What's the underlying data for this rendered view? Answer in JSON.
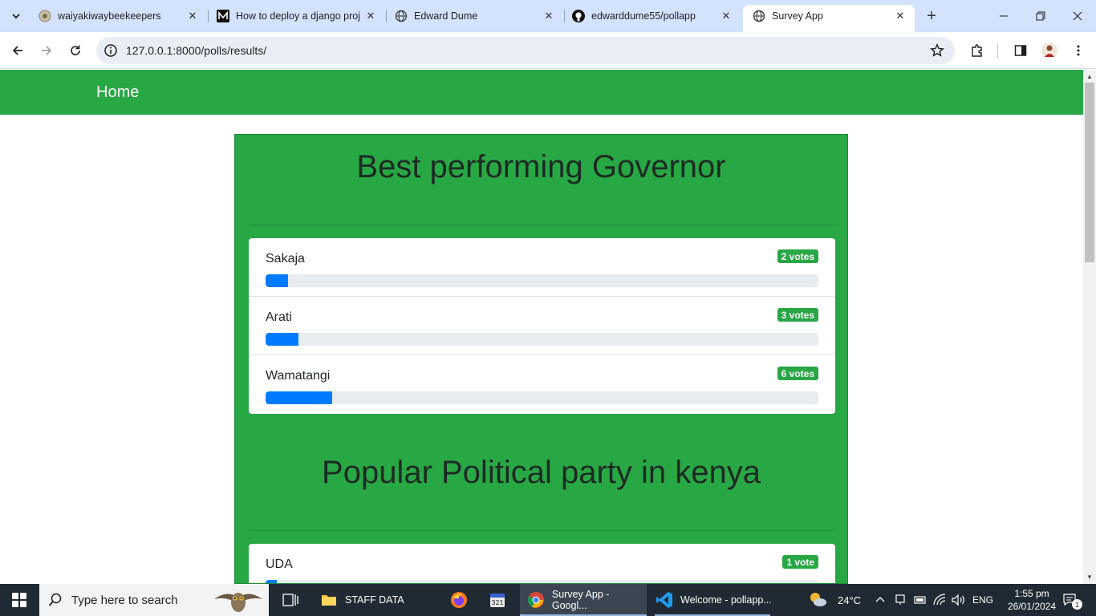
{
  "browser": {
    "tabs": [
      {
        "title": "waiyakiwaybeekeepers",
        "icon": "site-icon"
      },
      {
        "title": "How to deploy a django proj",
        "icon": "medium-icon"
      },
      {
        "title": "Edward Dume",
        "icon": "globe-icon"
      },
      {
        "title": "edwarddume55/pollapp",
        "icon": "github-icon"
      },
      {
        "title": "Survey App",
        "icon": "globe-icon",
        "active": true
      }
    ],
    "url": "127.0.0.1:8000/polls/results/"
  },
  "page": {
    "nav": {
      "brand": "Home"
    },
    "polls": [
      {
        "question": "Best performing Governor",
        "choices": [
          {
            "label": "Sakaja",
            "votes_label": "2 votes",
            "votes": 2
          },
          {
            "label": "Arati",
            "votes_label": "3 votes",
            "votes": 3
          },
          {
            "label": "Wamatangi",
            "votes_label": "6 votes",
            "votes": 6
          }
        ]
      },
      {
        "question": "Popular Political party in kenya",
        "choices": [
          {
            "label": "UDA",
            "votes_label": "1 vote",
            "votes": 1
          }
        ]
      }
    ],
    "colors": {
      "navbar": "#28a745",
      "badge": "#28a745",
      "progress": "#007bff"
    }
  },
  "taskbar": {
    "search_placeholder": "Type here to search",
    "apps": [
      {
        "label": "STAFF DATA",
        "icon": "folder-icon"
      },
      {
        "label": "Survey App - Googl...",
        "icon": "chrome-icon"
      },
      {
        "label": "Welcome - pollapp...",
        "icon": "vscode-icon"
      }
    ],
    "weather": "24°C",
    "language": "ENG",
    "time": "1:55 pm",
    "date": "26/01/2024",
    "notifications": "1"
  }
}
